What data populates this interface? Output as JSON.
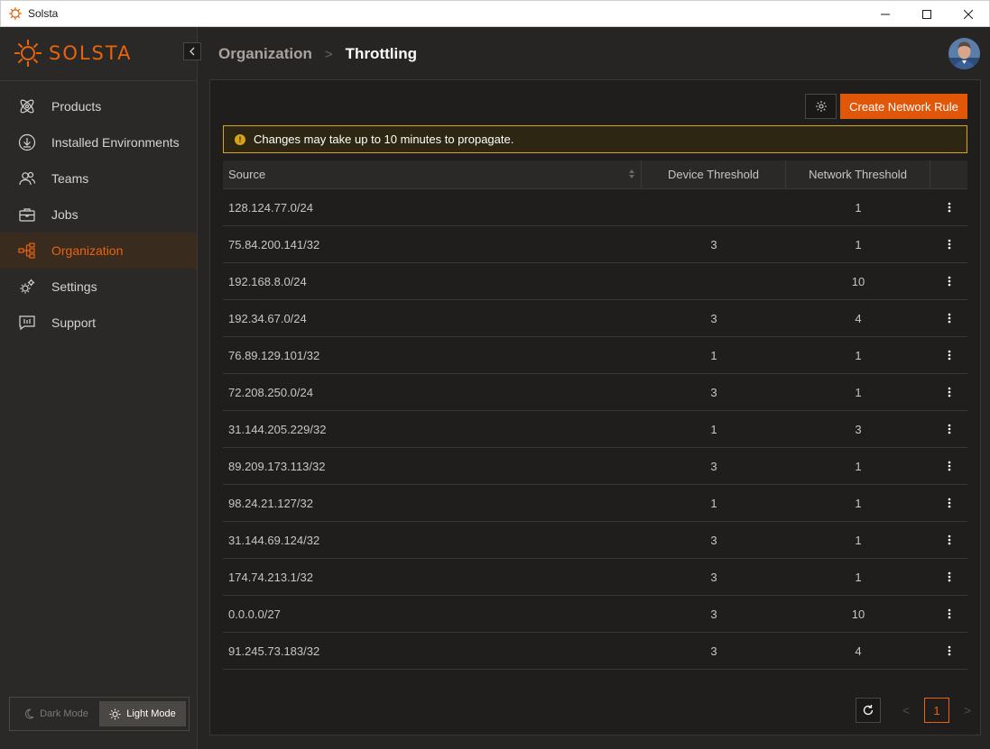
{
  "window": {
    "title": "Solsta",
    "controls": [
      "minimize-icon",
      "maximize-icon",
      "close-icon"
    ]
  },
  "brand": {
    "name": "SOLSTA",
    "accent": "#e8640c"
  },
  "sidebar": {
    "items": [
      {
        "label": "Products",
        "icon": "atom-icon"
      },
      {
        "label": "Installed Environments",
        "icon": "download-icon"
      },
      {
        "label": "Teams",
        "icon": "users-icon"
      },
      {
        "label": "Jobs",
        "icon": "briefcase-icon"
      },
      {
        "label": "Organization",
        "icon": "org-chart-icon",
        "active": true
      },
      {
        "label": "Settings",
        "icon": "gears-icon"
      },
      {
        "label": "Support",
        "icon": "chat-icon"
      }
    ],
    "mode": {
      "dark": "Dark Mode",
      "light": "Light Mode",
      "selected": "Light Mode"
    }
  },
  "breadcrumb": {
    "parent": "Organization",
    "separator": ">",
    "current": "Throttling"
  },
  "toolbar": {
    "create_label": "Create Network Rule"
  },
  "alert": {
    "text": "Changes may take up to 10 minutes to propagate.",
    "color": "#d8a21b"
  },
  "table": {
    "headers": {
      "source": "Source",
      "device": "Device Threshold",
      "network": "Network Threshold"
    },
    "rows": [
      {
        "source": "128.124.77.0/24",
        "device": "",
        "network": "1"
      },
      {
        "source": "75.84.200.141/32",
        "device": "3",
        "network": "1"
      },
      {
        "source": "192.168.8.0/24",
        "device": "",
        "network": "10"
      },
      {
        "source": "192.34.67.0/24",
        "device": "3",
        "network": "4"
      },
      {
        "source": "76.89.129.101/32",
        "device": "1",
        "network": "1"
      },
      {
        "source": "72.208.250.0/24",
        "device": "3",
        "network": "1"
      },
      {
        "source": "31.144.205.229/32",
        "device": "1",
        "network": "3"
      },
      {
        "source": "89.209.173.113/32",
        "device": "3",
        "network": "1"
      },
      {
        "source": "98.24.21.127/32",
        "device": "1",
        "network": "1"
      },
      {
        "source": "31.144.69.124/32",
        "device": "3",
        "network": "1"
      },
      {
        "source": "174.74.213.1/32",
        "device": "3",
        "network": "1"
      },
      {
        "source": "0.0.0.0/27",
        "device": "3",
        "network": "10"
      },
      {
        "source": "91.245.73.183/32",
        "device": "3",
        "network": "4"
      }
    ]
  },
  "pagination": {
    "current_page": "1",
    "prev": "<",
    "next": ">"
  }
}
